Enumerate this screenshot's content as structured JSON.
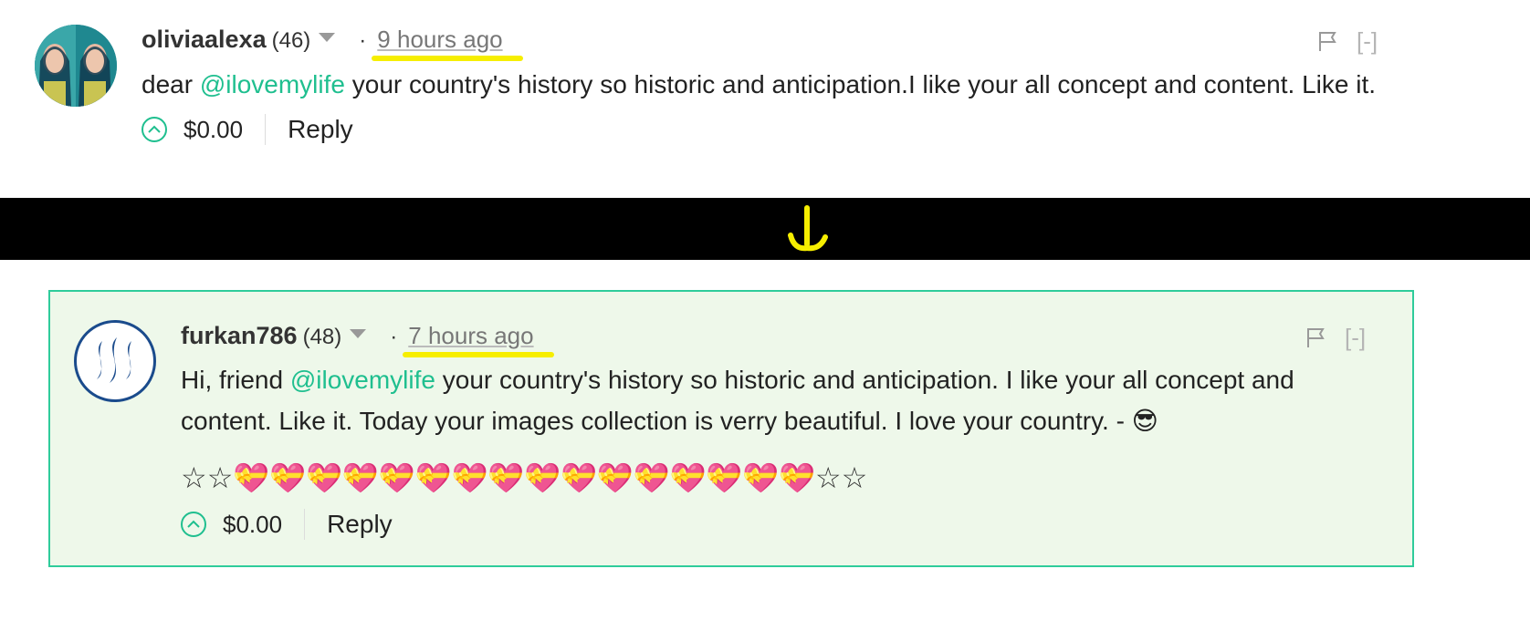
{
  "comment1": {
    "author": "oliviaalexa",
    "reputation": "(46)",
    "separator": "·",
    "time": "9 hours ago",
    "body_prefix": "dear",
    "mention": "@ilovemylife",
    "body_suffix": "your country's history so historic and anticipation.I like your all concept and content. Like it.",
    "payout": "$0.00",
    "reply_label": "Reply",
    "collapse_label": "[-]"
  },
  "comment2": {
    "author": "furkan786",
    "reputation": "(48)",
    "separator": "·",
    "time": "7 hours ago",
    "body_prefix": "Hi, friend",
    "mention": "@ilovemylife",
    "body_suffix": "your country's history so historic and anticipation. I like your all concept and content. Like it. Today your images collection is verry beautiful. I love your country. - 😎",
    "emoji_line": "☆☆💝💝💝💝💝💝💝💝💝💝💝💝💝💝💝💝☆☆",
    "payout": "$0.00",
    "reply_label": "Reply",
    "collapse_label": "[-]"
  },
  "colors": {
    "accent_green": "#1fbf8f",
    "highlight_yellow": "#f6ee00",
    "reply_bg": "#eef8ea",
    "band": "#000000"
  },
  "icons": [
    "flag-icon",
    "upvote-icon",
    "chevron-down-icon",
    "arrow-down-icon",
    "steem-logo-icon"
  ]
}
